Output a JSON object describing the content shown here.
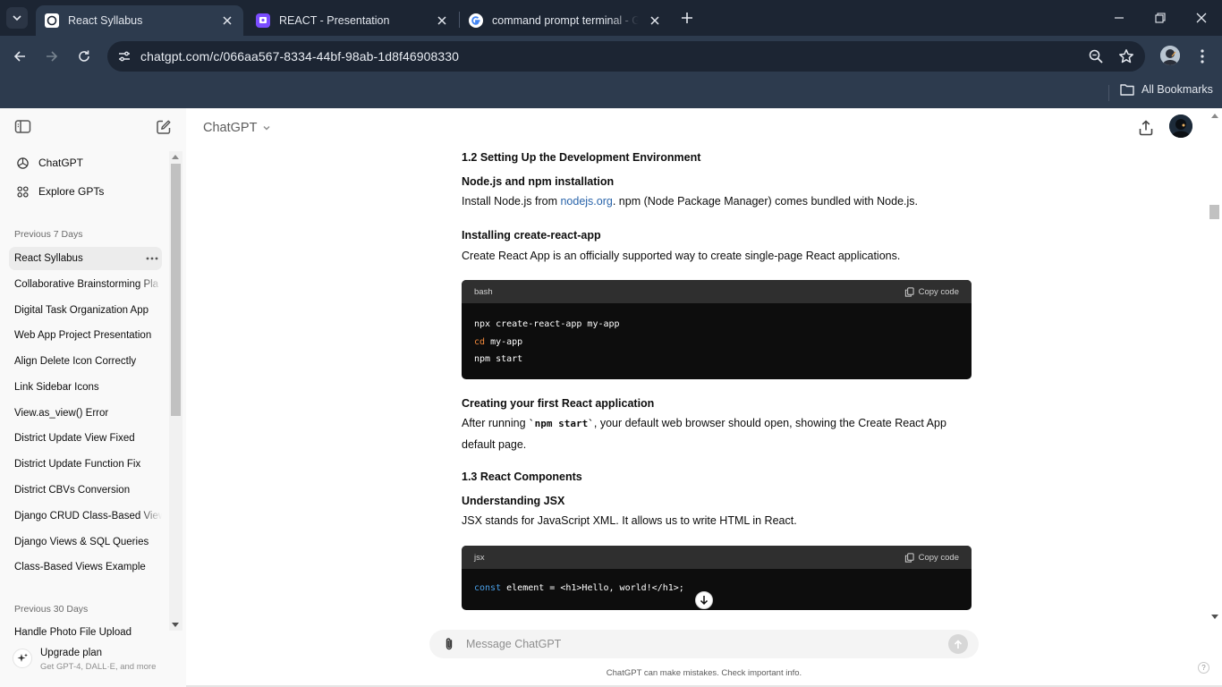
{
  "browser": {
    "tabs": [
      {
        "title": "React Syllabus",
        "active": true
      },
      {
        "title": "REACT - Presentation",
        "active": false
      },
      {
        "title": "command prompt terminal - Go",
        "active": false
      }
    ],
    "url": "chatgpt.com/c/066aa567-8334-44bf-98ab-1d8f46908330",
    "bookmarks_label": "All Bookmarks"
  },
  "sidebar": {
    "nav": [
      {
        "label": "ChatGPT",
        "icon": "openai-logo-icon"
      },
      {
        "label": "Explore GPTs",
        "icon": "grid-icon"
      }
    ],
    "section_7": "Previous 7 Days",
    "items_7": [
      "React Syllabus",
      "Collaborative Brainstorming Pla",
      "Digital Task Organization App",
      "Web App Project Presentation",
      "Align Delete Icon Correctly",
      "Link Sidebar Icons",
      "View.as_view() Error",
      "District Update View Fixed",
      "District Update Function Fix",
      "District CBVs Conversion",
      "Django CRUD Class-Based View",
      "Django Views & SQL Queries",
      "Class-Based Views Example"
    ],
    "section_30": "Previous 30 Days",
    "items_30": [
      "Handle Photo File Upload"
    ],
    "upgrade": {
      "title": "Upgrade plan",
      "subtitle": "Get GPT-4, DALL·E, and more"
    }
  },
  "main": {
    "model": "ChatGPT",
    "content": {
      "h_setup": "1.2 Setting Up the Development Environment",
      "h_node": "Node.js and npm installation",
      "p_node_a": "Install Node.js from ",
      "p_node_link": "nodejs.org",
      "p_node_b": ". npm (Node Package Manager) comes bundled with Node.js.",
      "h_cra": "Installing create-react-app",
      "p_cra": "Create React App is an officially supported way to create single-page React applications.",
      "code1": {
        "lang": "bash",
        "copy": "Copy code",
        "line1": "npx create-react-app my-app",
        "line2_cmd": "cd",
        "line2_rest": " my-app",
        "line3": "npm start"
      },
      "h_first": "Creating your first React application",
      "p_first_a": "After running ",
      "p_first_code": "`npm start`",
      "p_first_b": ", your default web browser should open, showing the Create React App default page.",
      "h_components": "1.3 React Components",
      "h_jsx": "Understanding JSX",
      "p_jsx": "JSX stands for JavaScript XML. It allows us to write HTML in React.",
      "code2": {
        "lang": "jsx",
        "copy": "Copy code",
        "kw": "const",
        "rest": " element = <h1>Hello, world!</h1>;"
      }
    },
    "composer_placeholder": "Message ChatGPT",
    "disclaimer": "ChatGPT can make mistakes. Check important info.",
    "help": "?"
  }
}
